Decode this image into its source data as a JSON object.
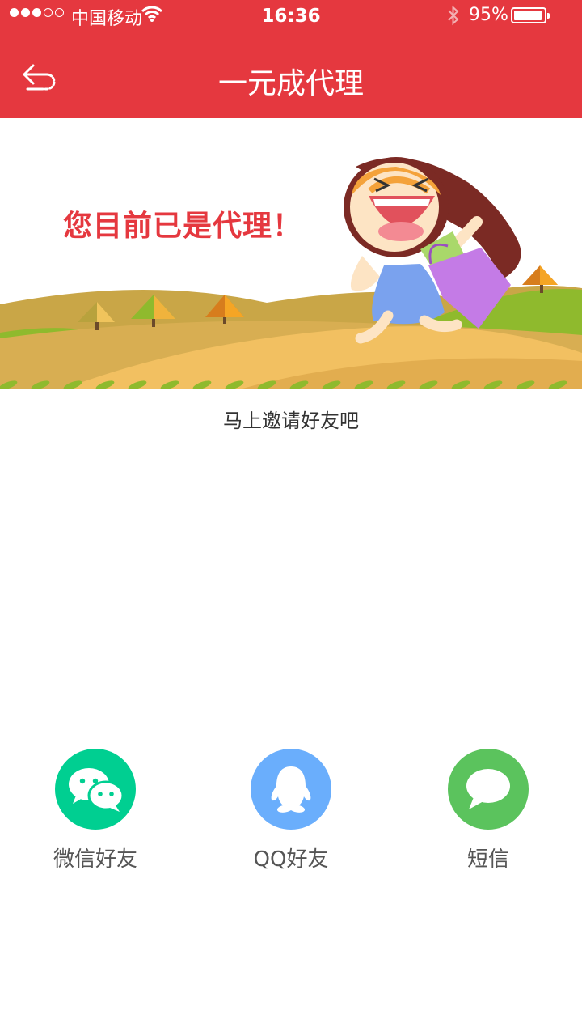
{
  "status_bar": {
    "carrier": "中国移动",
    "time": "16:36",
    "battery": "95%",
    "battery_level": 0.95
  },
  "header": {
    "title": "一元成代理",
    "back_icon": "back-arrow-icon"
  },
  "banner": {
    "message": "您目前已是代理！"
  },
  "section": {
    "heading": "马上邀请好友吧"
  },
  "share": [
    {
      "label": "微信好友",
      "icon": "wechat-icon",
      "color": "#00cf91"
    },
    {
      "label": "QQ好友",
      "icon": "qq-icon",
      "color": "#6aaefc"
    },
    {
      "label": "短信",
      "icon": "sms-icon",
      "color": "#5bc35d"
    }
  ],
  "colors": {
    "header": "#e5383f",
    "accent_text": "#e5383f"
  }
}
